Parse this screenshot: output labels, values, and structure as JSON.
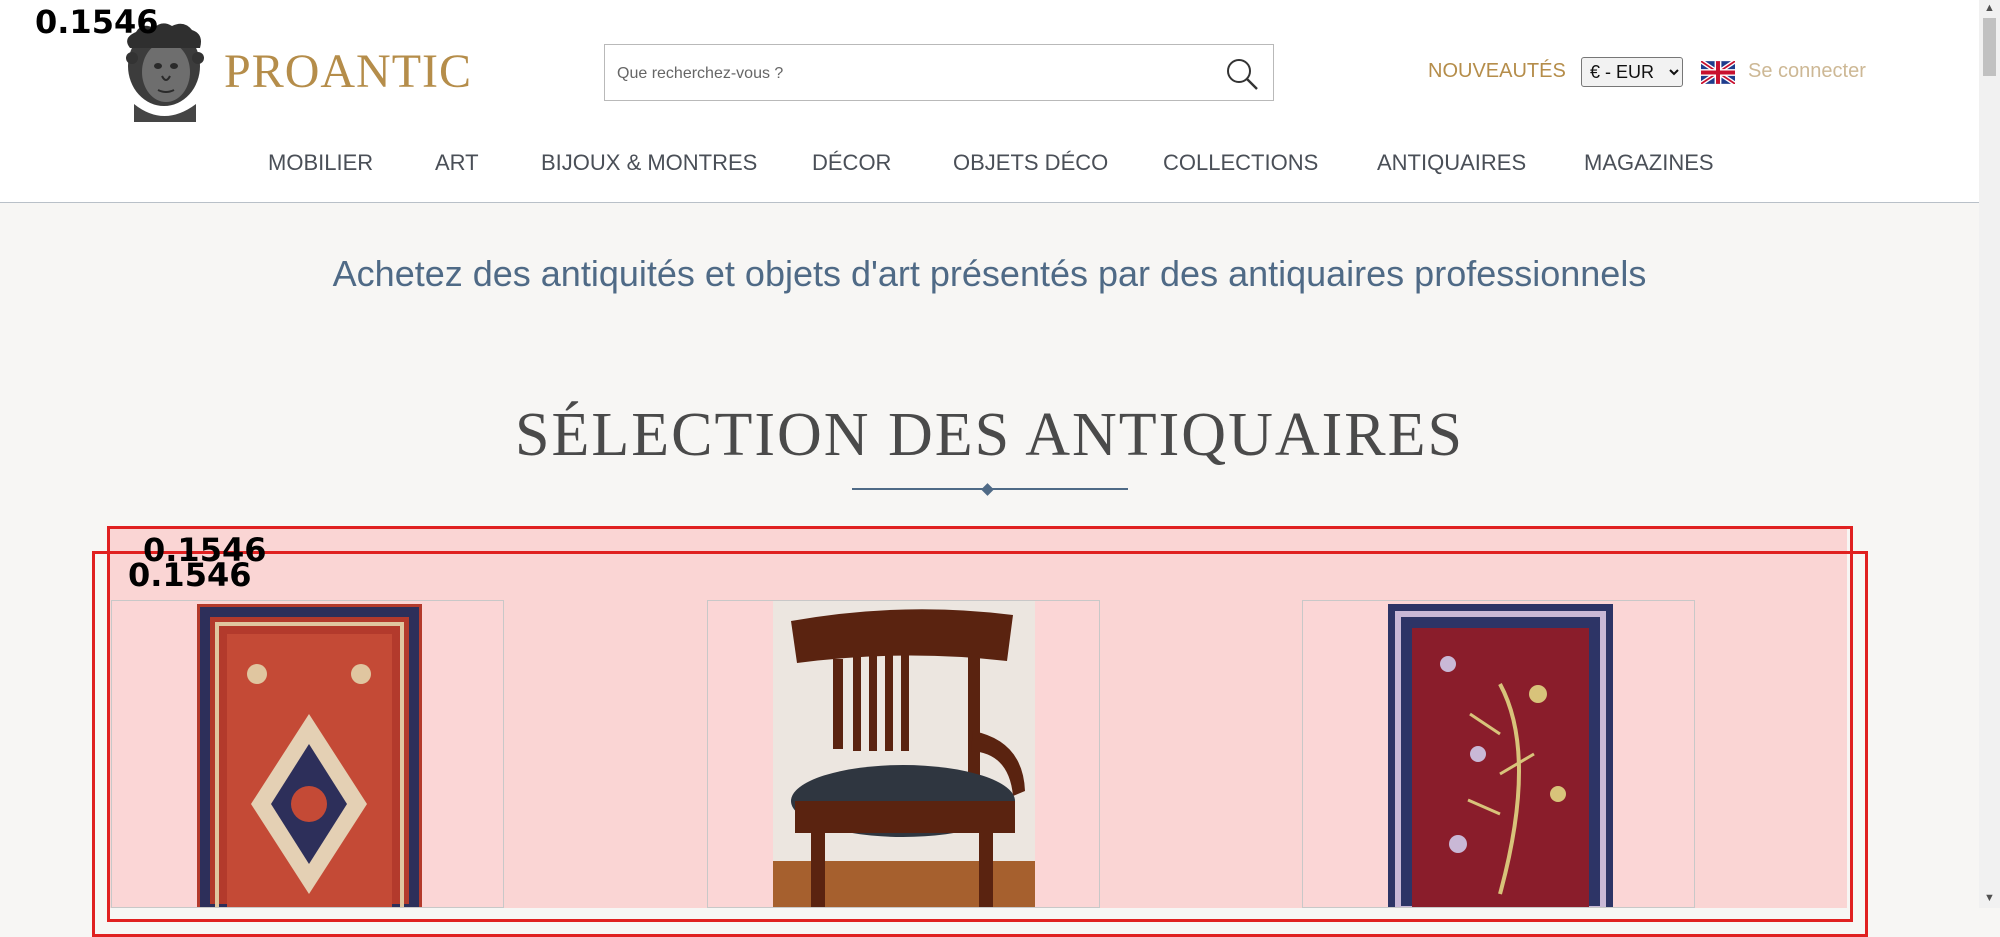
{
  "overlay": {
    "score_top": "0.1546",
    "score_box1": "0.1546",
    "score_box2": "0.1546"
  },
  "brand": {
    "name": "PROANTIC",
    "logo": "bust-logo"
  },
  "search": {
    "placeholder": "Que recherchez-vous ?",
    "value": "",
    "icon": "search-icon"
  },
  "header": {
    "new_label": "NOUVEAUTÉS",
    "currency": {
      "selected": "€ - EUR",
      "options": [
        "€ - EUR"
      ]
    },
    "language_flag": "uk-flag-icon",
    "login_label": "Se connecter"
  },
  "nav": {
    "items": [
      {
        "label": "MOBILIER"
      },
      {
        "label": "ART"
      },
      {
        "label": "BIJOUX & MONTRES"
      },
      {
        "label": "DÉCOR"
      },
      {
        "label": "OBJETS DÉCO"
      },
      {
        "label": "COLLECTIONS"
      },
      {
        "label": "ANTIQUAIRES"
      },
      {
        "label": "MAGAZINES"
      }
    ]
  },
  "main": {
    "tagline": "Achetez des antiquités et objets d'art présentés par des antiquaires professionnels",
    "section_title": "SÉLECTION DES ANTIQUAIRES"
  },
  "products": [
    {
      "image": "persian-rug-medallion"
    },
    {
      "image": "mahogany-armchair"
    },
    {
      "image": "persian-rug-animals"
    }
  ],
  "colors": {
    "brand_gold": "#b58d4a",
    "link_muted": "#cdb895",
    "nav_text": "#4a4f57",
    "tagline_blue": "#4f6a86",
    "background": "#f7f6f4",
    "highlight_red": "#e02020"
  }
}
